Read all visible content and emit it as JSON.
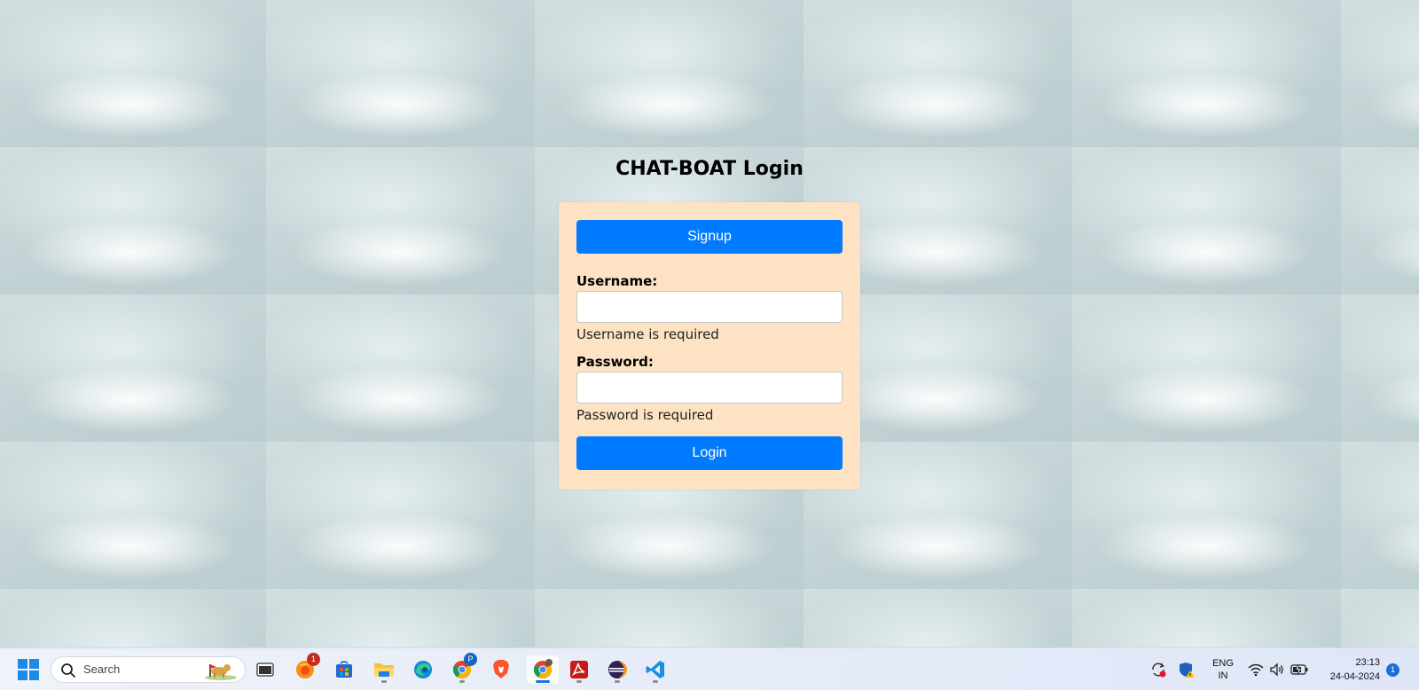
{
  "login": {
    "title": "CHAT-BOAT Login",
    "signup_label": "Signup",
    "username_label": "Username:",
    "username_value": "",
    "username_error": "Username is required",
    "password_label": "Password:",
    "password_value": "",
    "password_error": "Password is required",
    "login_label": "Login"
  },
  "colors": {
    "button": "#007bff",
    "card": "#fde3c4",
    "background": "#c3d3d5"
  },
  "taskbar": {
    "search_placeholder": "Search",
    "apps": [
      {
        "name": "task-view",
        "icon": "task-view-icon"
      },
      {
        "name": "firefox",
        "icon": "firefox-icon",
        "badge": "1"
      },
      {
        "name": "microsoft-store",
        "icon": "store-icon"
      },
      {
        "name": "file-explorer",
        "icon": "folder-icon"
      },
      {
        "name": "edge",
        "icon": "edge-icon"
      },
      {
        "name": "chrome-profile",
        "icon": "chrome-icon",
        "badge": "P"
      },
      {
        "name": "brave",
        "icon": "brave-icon"
      },
      {
        "name": "chrome",
        "icon": "chrome-icon",
        "active": true
      },
      {
        "name": "acrobat",
        "icon": "pdf-icon"
      },
      {
        "name": "eclipse",
        "icon": "eclipse-icon"
      },
      {
        "name": "vscode",
        "icon": "vscode-icon"
      }
    ],
    "tray": {
      "lang_top": "ENG",
      "lang_bottom": "IN",
      "time": "23:13",
      "date": "24-04-2024",
      "notifications": "1"
    }
  }
}
